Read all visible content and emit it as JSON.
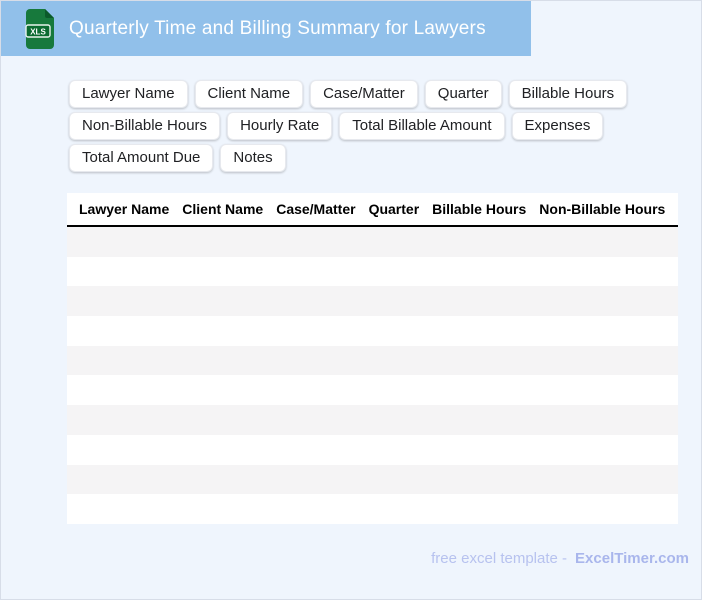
{
  "header": {
    "title": "Quarterly Time and Billing Summary for Lawyers",
    "icon_label": "XLS"
  },
  "chips": [
    "Lawyer Name",
    "Client Name",
    "Case/Matter",
    "Quarter",
    "Billable Hours",
    "Non-Billable Hours",
    "Hourly Rate",
    "Total Billable Amount",
    "Expenses",
    "Total Amount Due",
    "Notes"
  ],
  "table": {
    "columns": [
      "Lawyer Name",
      "Client Name",
      "Case/Matter",
      "Quarter",
      "Billable Hours",
      "Non-Billable Hours"
    ],
    "empty_rows": 10
  },
  "footer": {
    "text": "free excel template -",
    "brand": "ExcelTimer.com"
  },
  "colors": {
    "header_band": "#91c0ea",
    "page_background": "#eff5fd",
    "page_border": "#d7dde8",
    "row_stripe": "#f5f4f5",
    "icon_green": "#17793c",
    "icon_green_dark": "#0c6b31",
    "footer_text": "#b7c2ef",
    "footer_brand": "#a9b6ec"
  }
}
